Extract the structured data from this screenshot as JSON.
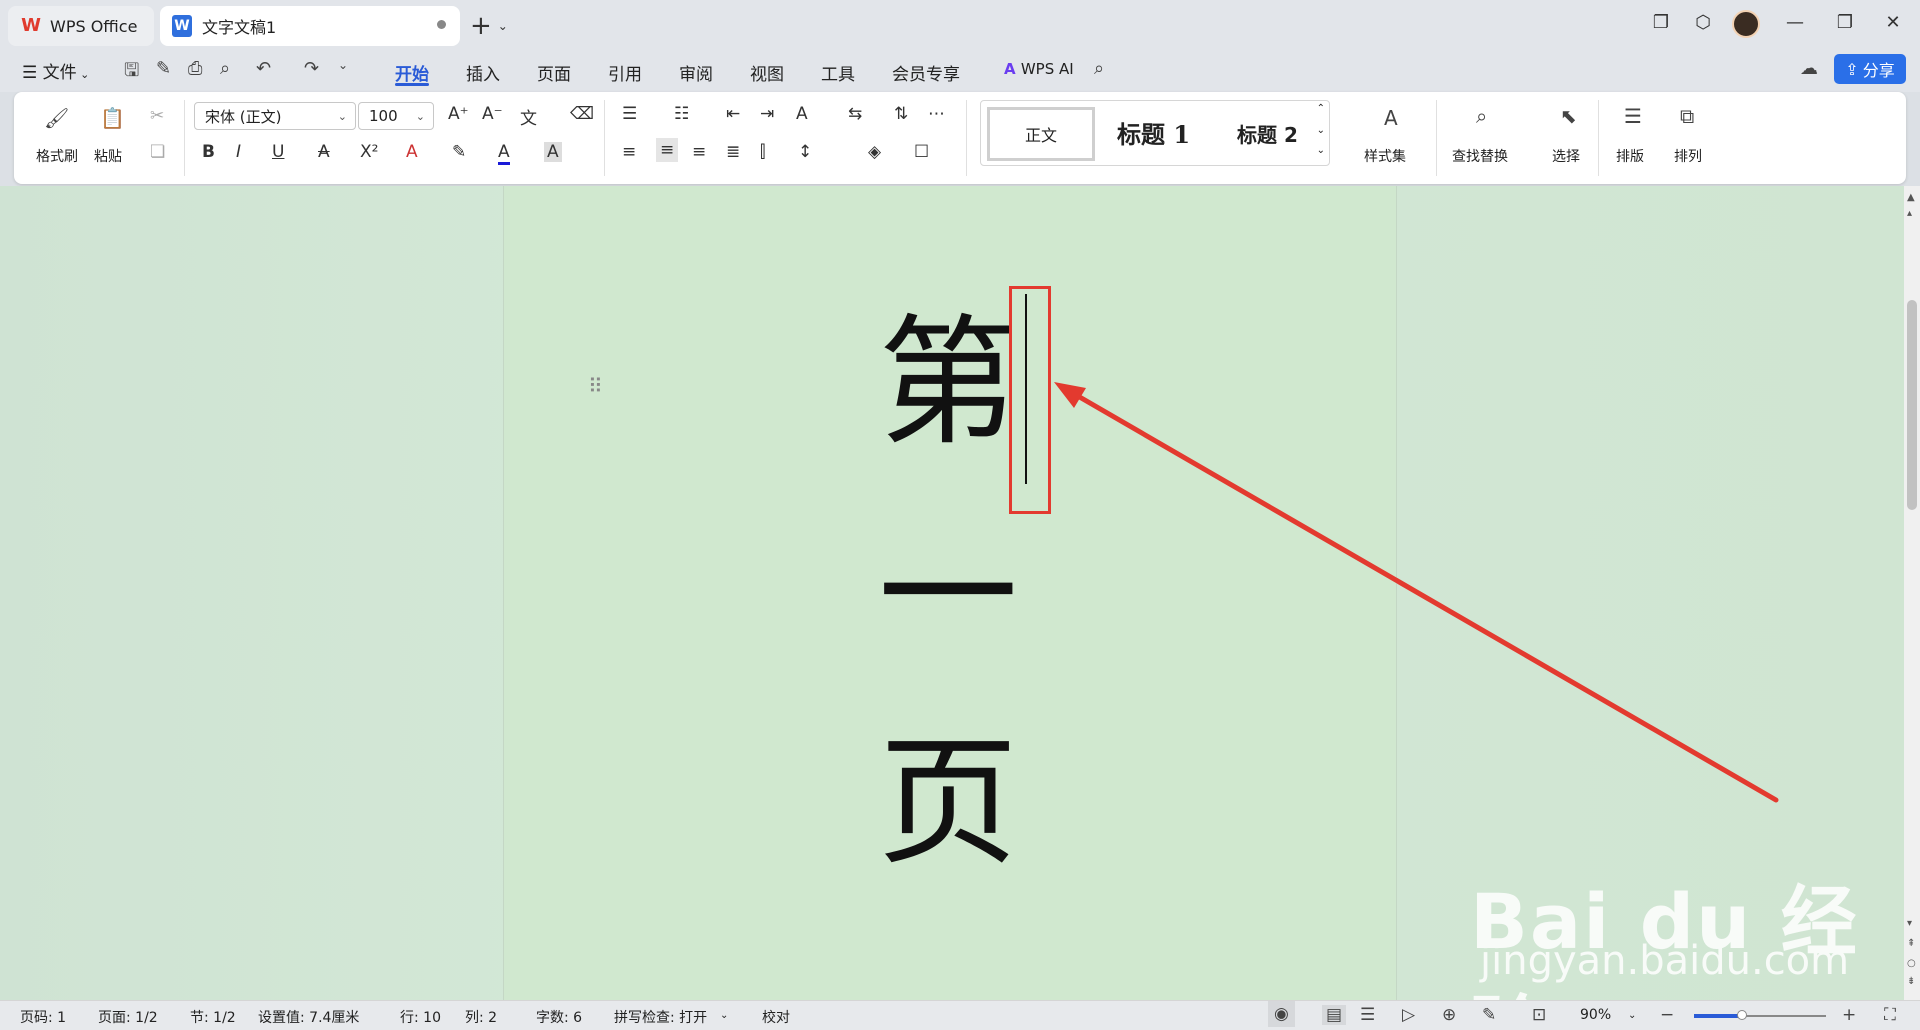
{
  "titlebar": {
    "tabs": [
      {
        "label": "WPS Office",
        "icon": "wps-logo-icon"
      },
      {
        "label": "文字文稿1",
        "icon": "writer-doc-icon",
        "modified": true
      }
    ],
    "new_tab_symbol": "+"
  },
  "menubar": {
    "file_label": "文件",
    "items": [
      "开始",
      "插入",
      "页面",
      "引用",
      "审阅",
      "视图",
      "工具",
      "会员专享"
    ],
    "active_item": "开始",
    "ai_label": "WPS AI",
    "share_label": "分享"
  },
  "ribbon": {
    "format_painter": "格式刷",
    "paste": "粘贴",
    "font_name": "宋体 (正文)",
    "font_size": "100",
    "styles": {
      "normal": "正文",
      "h1": "标题 1",
      "h2": "标题 2"
    },
    "style_set": "样式集",
    "find_replace": "查找替换",
    "select": "选择",
    "layout": "排版",
    "arrange": "排列"
  },
  "document": {
    "chars": [
      "第",
      "一",
      "页"
    ]
  },
  "watermark": {
    "main": "Bai du 经验",
    "sub": "jingyan.baidu.com"
  },
  "statusbar": {
    "page_code": "页码: 1",
    "page": "页面: 1/2",
    "section": "节: 1/2",
    "setting": "设置值: 7.4厘米",
    "row": "行: 10",
    "col": "列: 2",
    "word_count": "字数: 6",
    "spell_check": "拼写检查: 打开",
    "proofread": "校对",
    "zoom": "90%",
    "zoom_fraction": 0.36
  },
  "colors": {
    "accent": "#2a5bd7",
    "annotation_red": "#e33a2f",
    "page_background": "#d0e8cf"
  }
}
